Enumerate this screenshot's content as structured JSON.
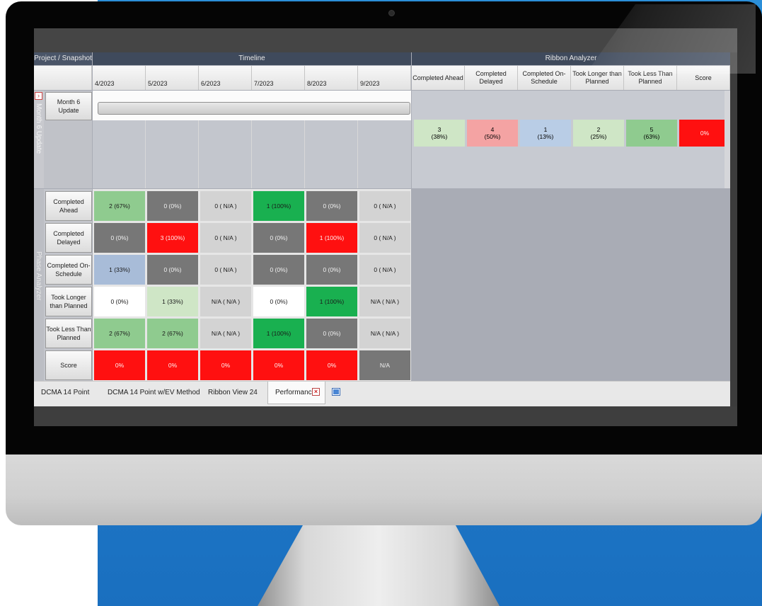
{
  "app": {
    "header": {
      "project_snapshot": "Project / Snapshot",
      "timeline": "Timeline",
      "ribbon_analyzer": "Ribbon Analyzer"
    },
    "timeline_months": [
      "4/2023",
      "5/2023",
      "6/2023",
      "7/2023",
      "8/2023",
      "9/2023"
    ],
    "ribbon_columns": [
      "Completed Ahead",
      "Completed Delayed",
      "Completed On-Schedule",
      "Took Longer than Planned",
      "Took Less Than Planned",
      "Score"
    ],
    "snapshot": {
      "strip_label": "Month 6 Update",
      "button_label": "Month 6 Update",
      "ribbon_values": [
        {
          "count": "3",
          "pct": "(38%)",
          "color": "#cfe6c6"
        },
        {
          "count": "4",
          "pct": "(50%)",
          "color": "#f4a3a3"
        },
        {
          "count": "1",
          "pct": "(13%)",
          "color": "#b9cde6"
        },
        {
          "count": "2",
          "pct": "(25%)",
          "color": "#cfe6c6"
        },
        {
          "count": "5",
          "pct": "(63%)",
          "color": "#8fcb8f"
        },
        {
          "count": "",
          "pct": "0%",
          "color": "#ff1010"
        }
      ]
    },
    "phase_analyzer": {
      "strip_label": "Phase Analyzer",
      "rows": [
        {
          "label": "Completed Ahead",
          "cells": [
            {
              "text": "2 (67%)",
              "color": "#8fcb8f",
              "fg": "#1a1a1a"
            },
            {
              "text": "0 (0%)",
              "color": "#777777",
              "fg": "#f0f0f0"
            },
            {
              "text": "0 ( N/A )",
              "color": "#d3d3d3",
              "fg": "#1a1a1a"
            },
            {
              "text": "1 (100%)",
              "color": "#19b050",
              "fg": "#1a1a1a"
            },
            {
              "text": "0 (0%)",
              "color": "#777777",
              "fg": "#f0f0f0"
            },
            {
              "text": "0 ( N/A )",
              "color": "#d3d3d3",
              "fg": "#1a1a1a"
            }
          ]
        },
        {
          "label": "Completed Delayed",
          "cells": [
            {
              "text": "0 (0%)",
              "color": "#777777",
              "fg": "#f0f0f0"
            },
            {
              "text": "3 (100%)",
              "color": "#ff1010",
              "fg": "#fff0f0"
            },
            {
              "text": "0 ( N/A )",
              "color": "#d3d3d3",
              "fg": "#1a1a1a"
            },
            {
              "text": "0 (0%)",
              "color": "#777777",
              "fg": "#f0f0f0"
            },
            {
              "text": "1 (100%)",
              "color": "#ff1010",
              "fg": "#fff0f0"
            },
            {
              "text": "0 ( N/A )",
              "color": "#d3d3d3",
              "fg": "#1a1a1a"
            }
          ]
        },
        {
          "label": "Completed On-Schedule",
          "cells": [
            {
              "text": "1 (33%)",
              "color": "#a8bcd8",
              "fg": "#1a1a1a"
            },
            {
              "text": "0 (0%)",
              "color": "#777777",
              "fg": "#f0f0f0"
            },
            {
              "text": "0 ( N/A )",
              "color": "#d3d3d3",
              "fg": "#1a1a1a"
            },
            {
              "text": "0 (0%)",
              "color": "#777777",
              "fg": "#f0f0f0"
            },
            {
              "text": "0 (0%)",
              "color": "#777777",
              "fg": "#f0f0f0"
            },
            {
              "text": "0 ( N/A )",
              "color": "#d3d3d3",
              "fg": "#1a1a1a"
            }
          ]
        },
        {
          "label": "Took Longer than Planned",
          "cells": [
            {
              "text": "0 (0%)",
              "color": "#ffffff",
              "fg": "#1a1a1a"
            },
            {
              "text": "1 (33%)",
              "color": "#cfe6c6",
              "fg": "#1a1a1a"
            },
            {
              "text": "N/A ( N/A )",
              "color": "#d3d3d3",
              "fg": "#1a1a1a"
            },
            {
              "text": "0 (0%)",
              "color": "#ffffff",
              "fg": "#1a1a1a"
            },
            {
              "text": "1 (100%)",
              "color": "#19b050",
              "fg": "#1a1a1a"
            },
            {
              "text": "N/A ( N/A )",
              "color": "#d3d3d3",
              "fg": "#1a1a1a"
            }
          ]
        },
        {
          "label": "Took Less Than Planned",
          "cells": [
            {
              "text": "2 (67%)",
              "color": "#8fcb8f",
              "fg": "#1a1a1a"
            },
            {
              "text": "2 (67%)",
              "color": "#8fcb8f",
              "fg": "#1a1a1a"
            },
            {
              "text": "N/A ( N/A )",
              "color": "#d3d3d3",
              "fg": "#1a1a1a"
            },
            {
              "text": "1 (100%)",
              "color": "#19b050",
              "fg": "#1a1a1a"
            },
            {
              "text": "0 (0%)",
              "color": "#777777",
              "fg": "#f0f0f0"
            },
            {
              "text": "N/A ( N/A )",
              "color": "#d3d3d3",
              "fg": "#1a1a1a"
            }
          ]
        },
        {
          "label": "Score",
          "cells": [
            {
              "text": "0%",
              "color": "#ff1010",
              "fg": "#fff0f0"
            },
            {
              "text": "0%",
              "color": "#ff1010",
              "fg": "#fff0f0"
            },
            {
              "text": "0%",
              "color": "#ff1010",
              "fg": "#fff0f0"
            },
            {
              "text": "0%",
              "color": "#ff1010",
              "fg": "#fff0f0"
            },
            {
              "text": "0%",
              "color": "#ff1010",
              "fg": "#fff0f0"
            },
            {
              "text": "N/A",
              "color": "#777777",
              "fg": "#f0f0f0"
            }
          ]
        }
      ]
    },
    "tabs": {
      "tab1": "DCMA 14 Point",
      "tab2": "DCMA 14 Point w/EV Method",
      "tab3": "Ribbon View 24",
      "tab4": "Performance"
    },
    "icons": {
      "close_tab": "close-icon",
      "new_tab": "window-icon",
      "collapse": "chevron-icon"
    }
  }
}
